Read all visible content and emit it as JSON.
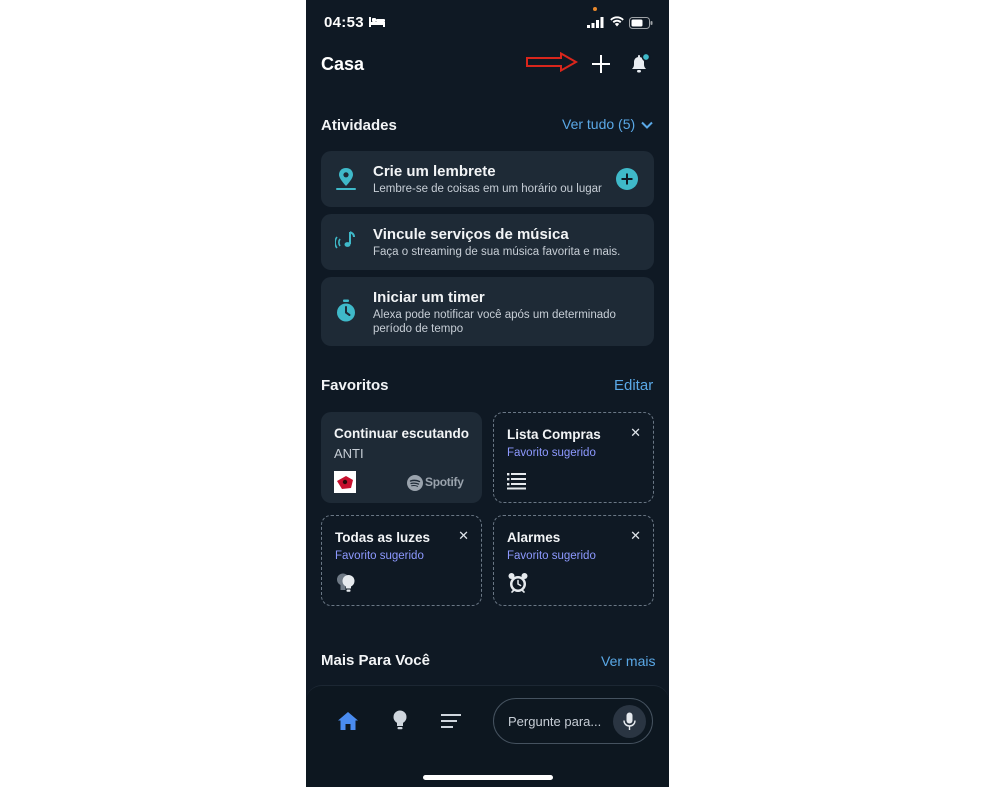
{
  "status_bar": {
    "time": "04:53"
  },
  "header": {
    "title": "Casa"
  },
  "activities": {
    "title": "Atividades",
    "see_all": "Ver tudo (5)",
    "items": [
      {
        "title": "Crie um lembrete",
        "subtitle": "Lembre-se de coisas em um horário ou lugar",
        "icon": "location-pin-icon"
      },
      {
        "title": "Vincule serviços de música",
        "subtitle": "Faça o streaming de sua música favorita e mais.",
        "icon": "music-note-icon"
      },
      {
        "title": "Iniciar um timer",
        "subtitle": "Alexa pode notificar você após um determinado período de tempo",
        "icon": "timer-icon"
      }
    ]
  },
  "favorites": {
    "title": "Favoritos",
    "edit": "Editar",
    "cards": [
      {
        "title": "Continuar escutando",
        "subtitle": "ANTI",
        "provider": "Spotify"
      },
      {
        "title": "Lista Compras",
        "subtitle": "Favorito sugerido",
        "icon": "list-icon"
      },
      {
        "title": "Todas as luzes",
        "subtitle": "Favorito sugerido",
        "icon": "lightbulbs-icon"
      },
      {
        "title": "Alarmes",
        "subtitle": "Favorito sugerido",
        "icon": "alarm-clock-icon"
      }
    ],
    "close_glyph": "✕"
  },
  "more_for_you": {
    "title": "Mais Para Você",
    "see_more": "Ver mais"
  },
  "bottom_nav": {
    "ask_placeholder": "Pergunte para..."
  },
  "colors": {
    "background": "#0f1924",
    "card": "#1e2a36",
    "accent": "#5aa8e6",
    "icon_teal": "#3fb9c9",
    "suggested": "#8d99ff",
    "annotation_arrow": "#d9261c"
  }
}
